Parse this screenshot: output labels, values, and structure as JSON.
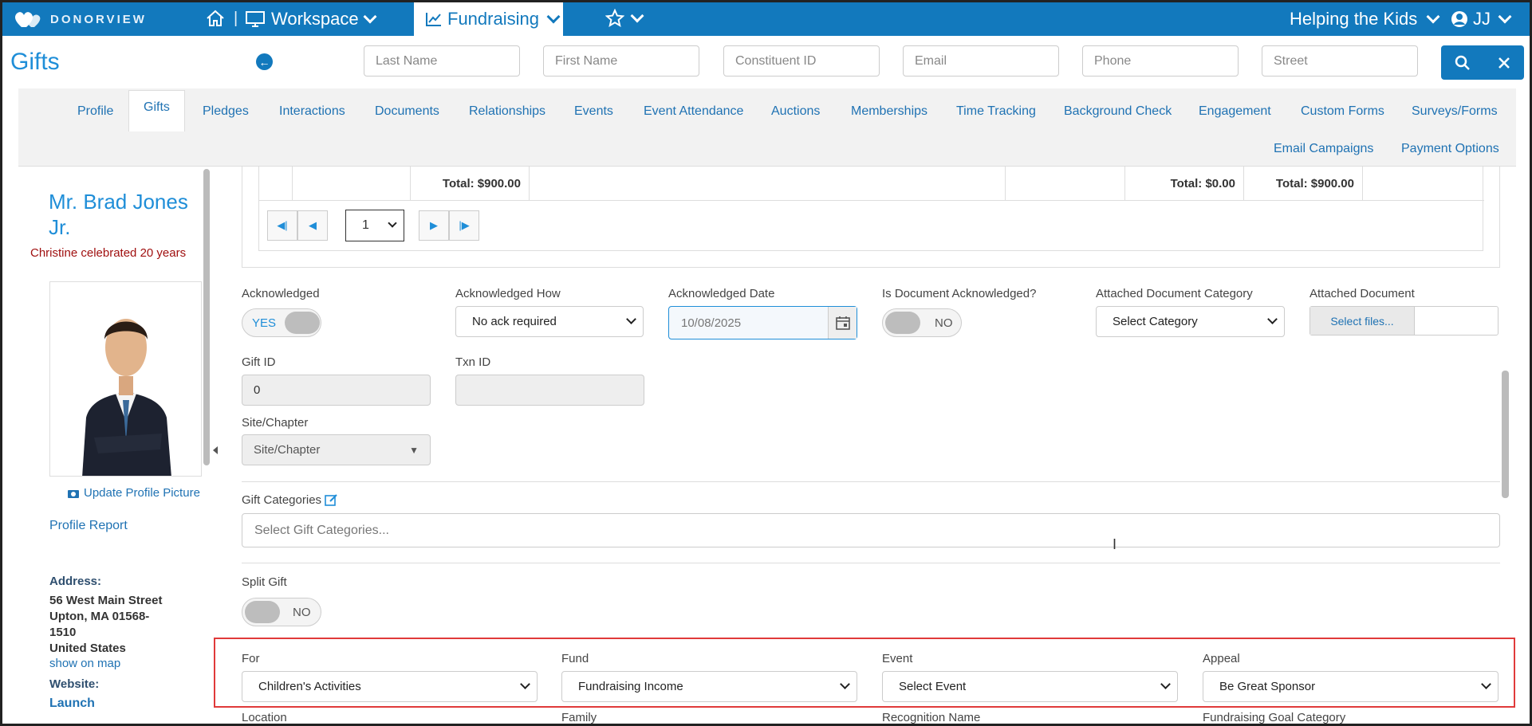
{
  "topbar": {
    "logo_text": "DONORVIEW",
    "separator": "|",
    "workspace_label": "Workspace",
    "fundraising_label": "Fundraising",
    "org_label": "Helping the Kids",
    "user_label": "JJ"
  },
  "header": {
    "title": "Gifts",
    "search_placeholders": [
      "Last Name",
      "First Name",
      "Constituent ID",
      "Email",
      "Phone",
      "Street"
    ]
  },
  "tabs": [
    "Profile",
    "Gifts",
    "Pledges",
    "Interactions",
    "Documents",
    "Relationships",
    "Events",
    "Event Attendance",
    "Auctions",
    "Memberships",
    "Time Tracking",
    "Background Check",
    "Engagement",
    "Custom Forms",
    "Surveys/Forms",
    "Email Campaigns",
    "Payment Options"
  ],
  "active_tab": "Gifts",
  "profile": {
    "name": "Mr. Brad Jones Jr.",
    "note": "Christine celebrated 20 years",
    "update_picture": "Update Profile Picture",
    "profile_report": "Profile Report",
    "address_label": "Address:",
    "address_lines": [
      "56 West Main Street",
      "Upton, MA 01568-",
      "1510",
      "United States"
    ],
    "show_on_map": "show on map",
    "website_label": "Website:",
    "website_link": "Launch"
  },
  "grid": {
    "totals": [
      "Total: $900.00",
      "Total: $0.00",
      "Total: $900.00"
    ],
    "page": "1"
  },
  "form": {
    "acknowledged": {
      "label": "Acknowledged",
      "state": "YES"
    },
    "ack_how": {
      "label": "Acknowledged How",
      "value": "No ack required"
    },
    "ack_date": {
      "label": "Acknowledged Date",
      "value": "10/08/2025"
    },
    "doc_ack": {
      "label": "Is Document Acknowledged?",
      "state": "NO"
    },
    "doc_category": {
      "label": "Attached Document Category",
      "value": "Select Category"
    },
    "attached_doc": {
      "label": "Attached Document",
      "button": "Select files..."
    },
    "gift_id": {
      "label": "Gift ID",
      "value": "0"
    },
    "txn_id": {
      "label": "Txn ID",
      "value": ""
    },
    "site": {
      "label": "Site/Chapter",
      "value": "Site/Chapter"
    },
    "gift_categories": {
      "label": "Gift Categories",
      "placeholder": "Select Gift Categories..."
    },
    "split_gift": {
      "label": "Split Gift",
      "state": "NO"
    },
    "for": {
      "label": "For",
      "value": "Children's Activities"
    },
    "fund": {
      "label": "Fund",
      "value": "Fundraising Income"
    },
    "event": {
      "label": "Event",
      "value": "Select Event"
    },
    "appeal": {
      "label": "Appeal",
      "value": "Be Great Sponsor"
    },
    "bottom_labels": [
      "Location",
      "Family",
      "Recognition Name",
      "Fundraising Goal Category"
    ]
  },
  "colors": {
    "brand": "#1279bd",
    "link": "#1f72b3",
    "highlight": "#e03a3a",
    "note": "#a01010"
  }
}
